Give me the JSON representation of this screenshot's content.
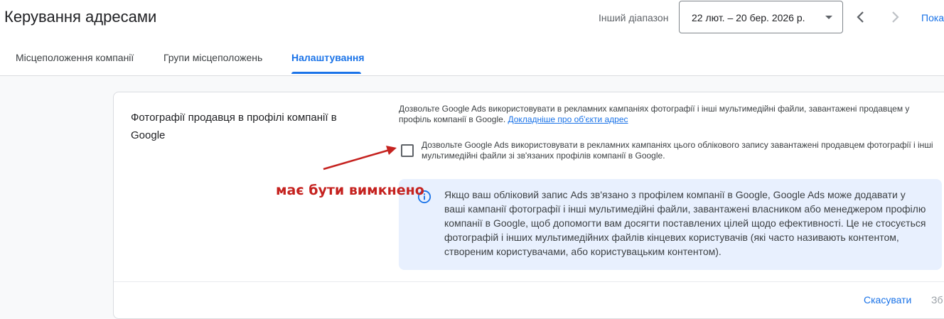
{
  "header": {
    "title": "Керування адресами",
    "range_label": "Інший діапазон",
    "date_range": "22 лют. – 20 бер. 2026 р.",
    "show_link": "Пока"
  },
  "tabs": [
    {
      "label": "Місцеположення компанії",
      "active": false
    },
    {
      "label": "Групи місцеположень",
      "active": false
    },
    {
      "label": "Налаштування",
      "active": true
    }
  ],
  "section": {
    "title": "Фотографії продавця в профілі компанії в Google",
    "description": "Дозвольте Google Ads використовувати в рекламних кампаніях фотографії і інші мультимедійні файли, завантажені продавцем у профіль компанії в Google.",
    "learn_more": "Докладніше про об'єкти адрес",
    "checkbox_label": "Дозвольте Google Ads використовувати в рекламних кампаніях цього облікового запису завантажені продавцем фотографії і інші мультимедійні файли зі зв'язаних профілів компанії в Google.",
    "checkbox_checked": false,
    "info_text": "Якщо ваш обліковий запис Ads зв'язано з профілем компанії в Google, Google Ads може додавати у ваші кампанії фотографії і інші мультимедійні файли, завантажені власником або менеджером профілю компанії в Google, щоб допомогти вам досягти поставлених цілей щодо ефективності. Це не стосується фотографій і інших мультимедійних файлів кінцевих користувачів (які часто називають контентом, створеним користувачами, або користувацьким контентом)."
  },
  "annotation": {
    "text": "має бути вимкнено",
    "color": "#c5221f"
  },
  "footer": {
    "cancel_label": "Скасувати",
    "save_label": "Зб"
  },
  "colors": {
    "accent": "#1a73e8",
    "info_bg": "#e8f0fe"
  },
  "icons": {
    "prev": "chevron-left-icon",
    "next": "chevron-right-icon",
    "dropdown": "caret-down-icon",
    "info": "info-icon"
  }
}
